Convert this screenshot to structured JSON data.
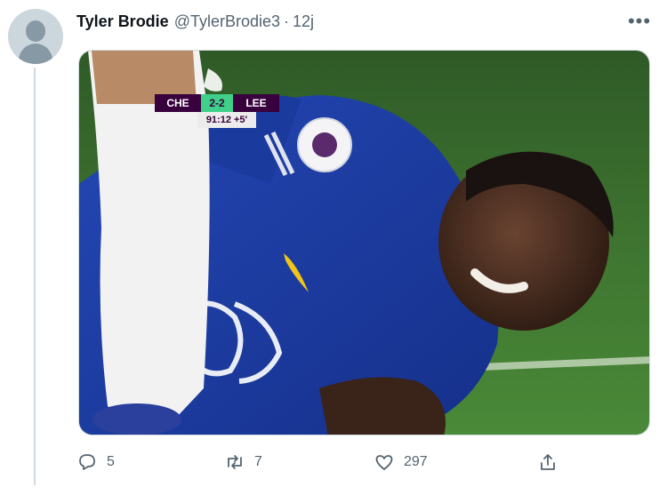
{
  "tweet": {
    "display_name": "Tyler Brodie",
    "handle": "@TylerBrodie3",
    "separator": "·",
    "time": "12j",
    "more_label": "•••"
  },
  "scorebug": {
    "home": "CHE",
    "score": "2-2",
    "away": "LEE",
    "clock": "91:12 +5'"
  },
  "actions": {
    "replies": "5",
    "retweets": "7",
    "likes": "297"
  },
  "icons": [
    "more-icon",
    "reply-icon",
    "retweet-icon",
    "like-icon",
    "share-icon",
    "premier-league-logo"
  ],
  "colors": {
    "text_secondary": "#536471",
    "thread_line": "#cfd9de",
    "pitch_green": "#3b6b2f",
    "kit_blue": "#1c3fa8",
    "scorebug_purple": "#38003c",
    "scorebug_green": "#3fd08a"
  }
}
